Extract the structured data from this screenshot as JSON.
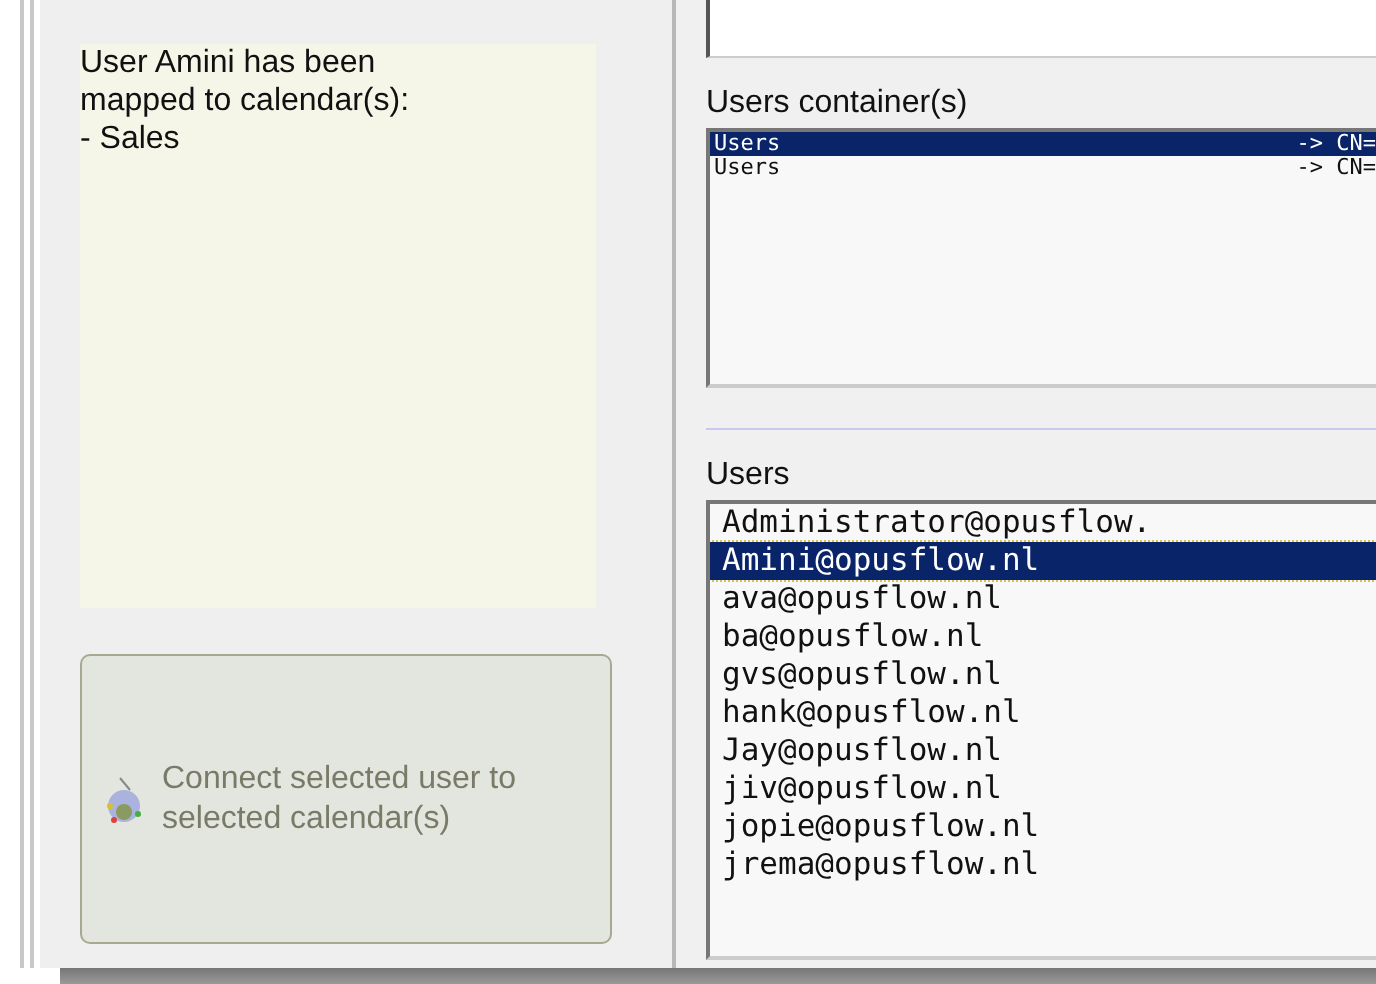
{
  "message": "User Amini has been mapped to calendar(s):\n- Sales",
  "connect_button": {
    "label": "Connect selected user to selected calendar(s)",
    "disabled": true
  },
  "containers": {
    "label": "Users container(s)",
    "items": [
      {
        "name": "Users",
        "path": "-> CN=",
        "selected": true
      },
      {
        "name": "Users",
        "path": "-> CN=",
        "selected": false
      }
    ]
  },
  "users": {
    "label": "Users",
    "items": [
      {
        "name": "Administrator@opusflow.",
        "selected": false
      },
      {
        "name": "Amini@opusflow.nl",
        "selected": true
      },
      {
        "name": "ava@opusflow.nl",
        "selected": false
      },
      {
        "name": "ba@opusflow.nl",
        "selected": false
      },
      {
        "name": "gvs@opusflow.nl",
        "selected": false
      },
      {
        "name": "hank@opusflow.nl",
        "selected": false
      },
      {
        "name": "Jay@opusflow.nl",
        "selected": false
      },
      {
        "name": "jiv@opusflow.nl",
        "selected": false
      },
      {
        "name": "jopie@opusflow.nl",
        "selected": false
      },
      {
        "name": "jrema@opusflow.nl",
        "selected": false
      }
    ]
  }
}
